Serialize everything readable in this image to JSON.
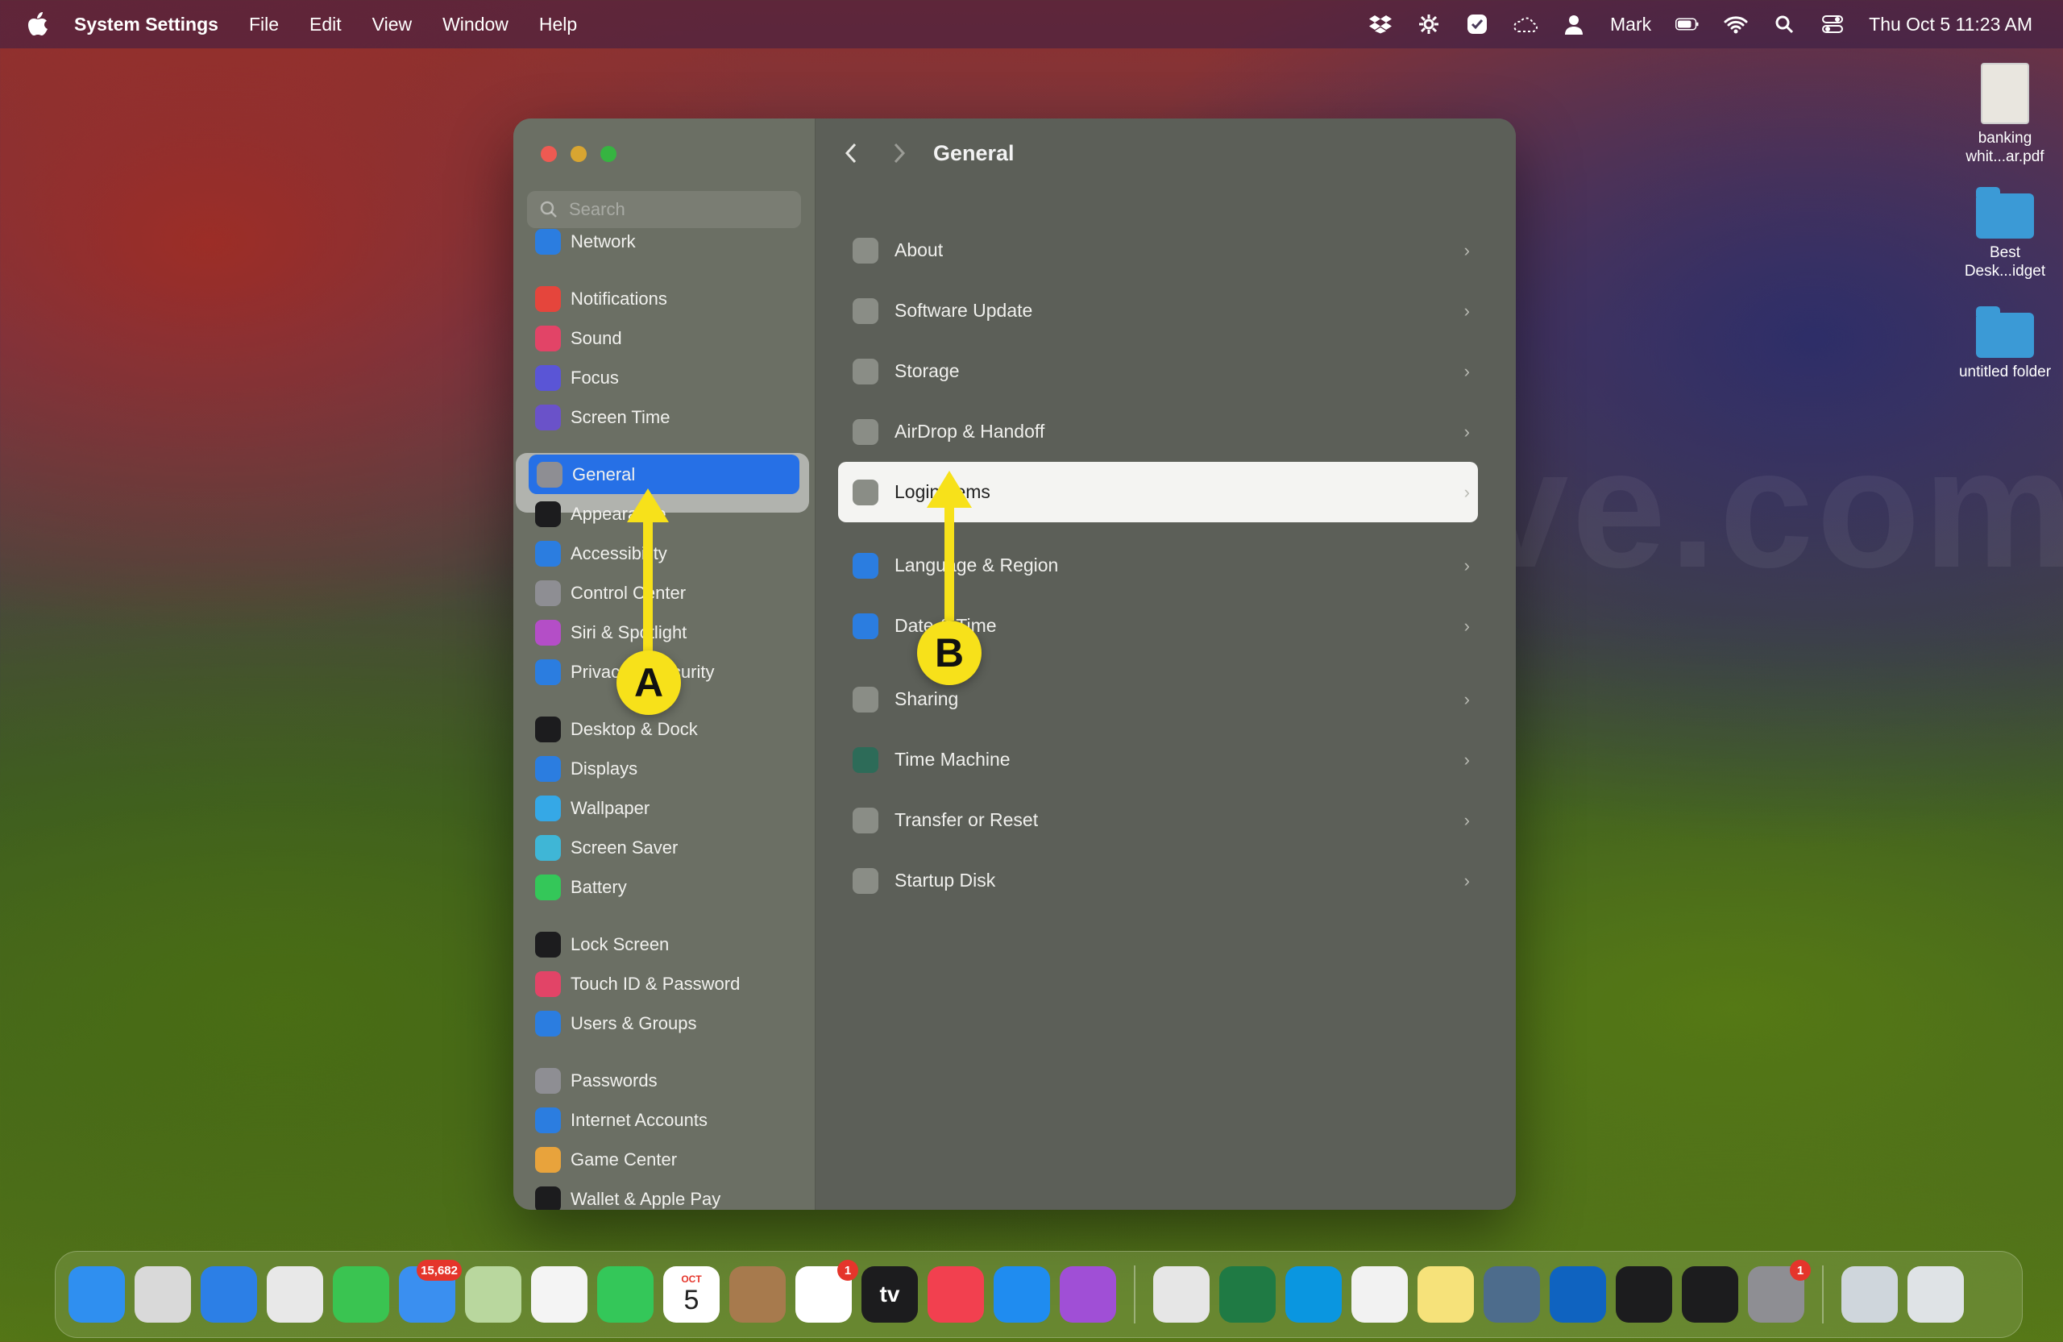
{
  "menubar": {
    "app_name": "System Settings",
    "menus": [
      "File",
      "Edit",
      "View",
      "Window",
      "Help"
    ],
    "user": "Mark",
    "datetime": "Thu Oct 5  11:23 AM"
  },
  "desktop": {
    "icons": [
      {
        "label": "banking whit...ar.pdf"
      },
      {
        "label": "Best Desk...idget"
      },
      {
        "label": "untitled folder"
      }
    ]
  },
  "window": {
    "search_placeholder": "Search",
    "sidebar": {
      "items": [
        {
          "label": "Network",
          "icon": "globe-icon",
          "color": "#2b7de0"
        },
        {
          "label": "Notifications",
          "icon": "bell-icon",
          "color": "#e5453c"
        },
        {
          "label": "Sound",
          "icon": "speaker-icon",
          "color": "#e24467"
        },
        {
          "label": "Focus",
          "icon": "moon-icon",
          "color": "#5a55d6"
        },
        {
          "label": "Screen Time",
          "icon": "hourglass-icon",
          "color": "#6a52c9"
        },
        {
          "label": "General",
          "icon": "gear-icon",
          "color": "#8e8e93"
        },
        {
          "label": "Appearance",
          "icon": "appearance-icon",
          "color": "#1c1c1e"
        },
        {
          "label": "Accessibility",
          "icon": "accessibility-icon",
          "color": "#2b7de0"
        },
        {
          "label": "Control Center",
          "icon": "control-center-icon",
          "color": "#8e8e93"
        },
        {
          "label": "Siri & Spotlight",
          "icon": "siri-icon",
          "color": "#b44ec7"
        },
        {
          "label": "Privacy & Security",
          "icon": "hand-icon",
          "color": "#2b7de0"
        },
        {
          "label": "Desktop & Dock",
          "icon": "dock-icon",
          "color": "#1c1c1e"
        },
        {
          "label": "Displays",
          "icon": "sun-icon",
          "color": "#2b7de0"
        },
        {
          "label": "Wallpaper",
          "icon": "flower-icon",
          "color": "#35a8e6"
        },
        {
          "label": "Screen Saver",
          "icon": "screensaver-icon",
          "color": "#3fb6d6"
        },
        {
          "label": "Battery",
          "icon": "battery-icon",
          "color": "#34c759"
        },
        {
          "label": "Lock Screen",
          "icon": "lock-icon",
          "color": "#1c1c1e"
        },
        {
          "label": "Touch ID & Password",
          "icon": "fingerprint-icon",
          "color": "#e24467"
        },
        {
          "label": "Users & Groups",
          "icon": "users-icon",
          "color": "#2b7de0"
        },
        {
          "label": "Passwords",
          "icon": "key-icon",
          "color": "#8e8e93"
        },
        {
          "label": "Internet Accounts",
          "icon": "at-icon",
          "color": "#2b7de0"
        },
        {
          "label": "Game Center",
          "icon": "game-center-icon",
          "color": "#e8a33c"
        },
        {
          "label": "Wallet & Apple Pay",
          "icon": "wallet-icon",
          "color": "#1c1c1e"
        }
      ]
    },
    "main": {
      "title": "General",
      "rows": [
        {
          "label": "About",
          "icon": "laptop-icon"
        },
        {
          "label": "Software Update",
          "icon": "update-gear-icon"
        },
        {
          "label": "Storage",
          "icon": "disk-icon"
        },
        {
          "label": "AirDrop & Handoff",
          "icon": "airdrop-icon"
        },
        {
          "label": "Login Items",
          "icon": "list-icon"
        },
        {
          "label": "Language & Region",
          "icon": "globe-icon"
        },
        {
          "label": "Date & Time",
          "icon": "calendar-icon"
        },
        {
          "label": "Sharing",
          "icon": "sharing-icon"
        },
        {
          "label": "Time Machine",
          "icon": "clock-icon"
        },
        {
          "label": "Transfer or Reset",
          "icon": "reset-icon"
        },
        {
          "label": "Startup Disk",
          "icon": "disk-icon"
        }
      ]
    }
  },
  "annotations": {
    "a_label": "A",
    "b_label": "B",
    "color": "#f7e11a"
  },
  "watermark": "iOSTodolve.com",
  "dock": {
    "apps": [
      {
        "name": "finder-app",
        "color": "#2f8ff0"
      },
      {
        "name": "launchpad-app",
        "color": "#d9d9d9"
      },
      {
        "name": "safari-app",
        "color": "#2c7fe6"
      },
      {
        "name": "opera-app",
        "color": "#e8e8e8"
      },
      {
        "name": "messages-app",
        "color": "#3ac451"
      },
      {
        "name": "mail-app",
        "color": "#3a8ff0",
        "badge": "15,682"
      },
      {
        "name": "maps-app",
        "color": "#b9d79e"
      },
      {
        "name": "photos-app",
        "color": "#f4f4f4"
      },
      {
        "name": "facetime-app",
        "color": "#34c759"
      },
      {
        "name": "calendar-app",
        "color": "#ffffff",
        "month": "OCT",
        "day": "5"
      },
      {
        "name": "contacts-app",
        "color": "#a77a4d"
      },
      {
        "name": "reminders-app",
        "color": "#ffffff",
        "badge": "1"
      },
      {
        "name": "appletv-app",
        "color": "#1c1c1e",
        "text": "tv"
      },
      {
        "name": "music-app",
        "color": "#f2404f"
      },
      {
        "name": "appstore-app",
        "color": "#1f8cf0"
      },
      {
        "name": "feedback-app",
        "color": "#a04fd6"
      },
      {
        "name": "chrome-app",
        "color": "#e6e6e6"
      },
      {
        "name": "excel-app",
        "color": "#1f7a44"
      },
      {
        "name": "skype-app",
        "color": "#0a96e0"
      },
      {
        "name": "freeform-app",
        "color": "#f2f2f2"
      },
      {
        "name": "notes-app",
        "color": "#f6e27a"
      },
      {
        "name": "preview-app",
        "color": "#4d6c8c"
      },
      {
        "name": "outlook-app",
        "color": "#0f63c0"
      },
      {
        "name": "activity-monitor-app",
        "color": "#1c1c1e"
      },
      {
        "name": "terminal-app",
        "color": "#1c1c1e"
      },
      {
        "name": "system-settings-app",
        "color": "#8e8e93",
        "badge": "1"
      },
      {
        "name": "downloads-stack",
        "color": "#cfd6dc"
      },
      {
        "name": "trash-app",
        "color": "#dfe3e6"
      }
    ]
  }
}
